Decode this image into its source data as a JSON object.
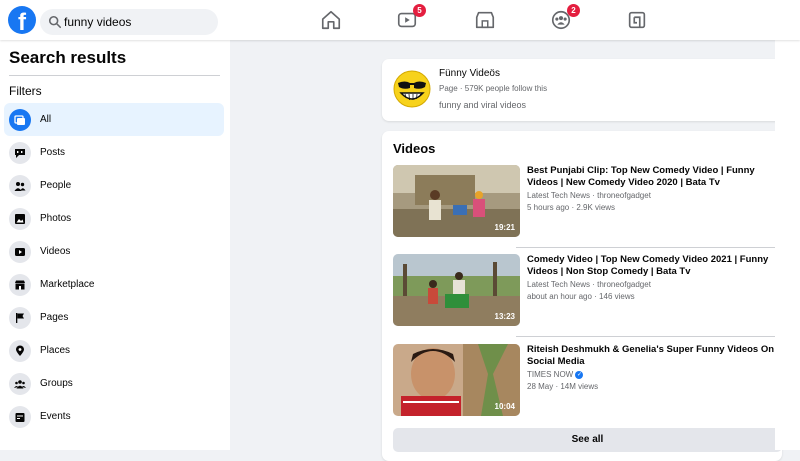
{
  "search": {
    "value": "funny videos"
  },
  "nav": {
    "home_icon": "home-icon",
    "watch_icon": "watch-icon",
    "watch_badge": "5",
    "marketplace_icon": "marketplace-icon",
    "groups_icon": "groups-icon",
    "groups_badge": "2",
    "gaming_icon": "gaming-icon"
  },
  "sidebar": {
    "title": "Search results",
    "filters_label": "Filters",
    "items": [
      {
        "label": "All",
        "icon": "all-icon",
        "active": true
      },
      {
        "label": "Posts",
        "icon": "posts-icon"
      },
      {
        "label": "People",
        "icon": "people-icon"
      },
      {
        "label": "Photos",
        "icon": "photos-icon"
      },
      {
        "label": "Videos",
        "icon": "videos-icon"
      },
      {
        "label": "Marketplace",
        "icon": "marketplace-icon"
      },
      {
        "label": "Pages",
        "icon": "pages-icon"
      },
      {
        "label": "Places",
        "icon": "places-icon"
      },
      {
        "label": "Groups",
        "icon": "groups-icon"
      },
      {
        "label": "Events",
        "icon": "events-icon"
      }
    ]
  },
  "page_result": {
    "name": "Fünny Videös",
    "meta": "Page · 579K people follow this",
    "description": "funny and viral videos"
  },
  "videos": {
    "title": "Videos",
    "items": [
      {
        "title": "Best Punjabi Clip: Top New Comedy Video | Funny Videos | New Comedy Video 2020 | Bata Tv",
        "source": "Latest Tech News · throneofgadget",
        "meta": "5 hours ago · 2.9K views",
        "duration": "19:21"
      },
      {
        "title": "Comedy Video | Top New Comedy Video 2021 | Funny Videos | Non Stop Comedy | Bata Tv",
        "source": "Latest Tech News · throneofgadget",
        "meta": "about an hour ago · 146 views",
        "duration": "13:23"
      },
      {
        "title": "Riteish Deshmukh & Genelia's Super Funny Videos On Social Media",
        "source": "TIMES NOW",
        "meta": "28 May · 14M views",
        "duration": "10:04"
      }
    ],
    "see_all": "See all"
  },
  "colors": {
    "accent": "#1877f2",
    "badge": "#e41e3f",
    "page_bg": "#f0f2f5"
  }
}
